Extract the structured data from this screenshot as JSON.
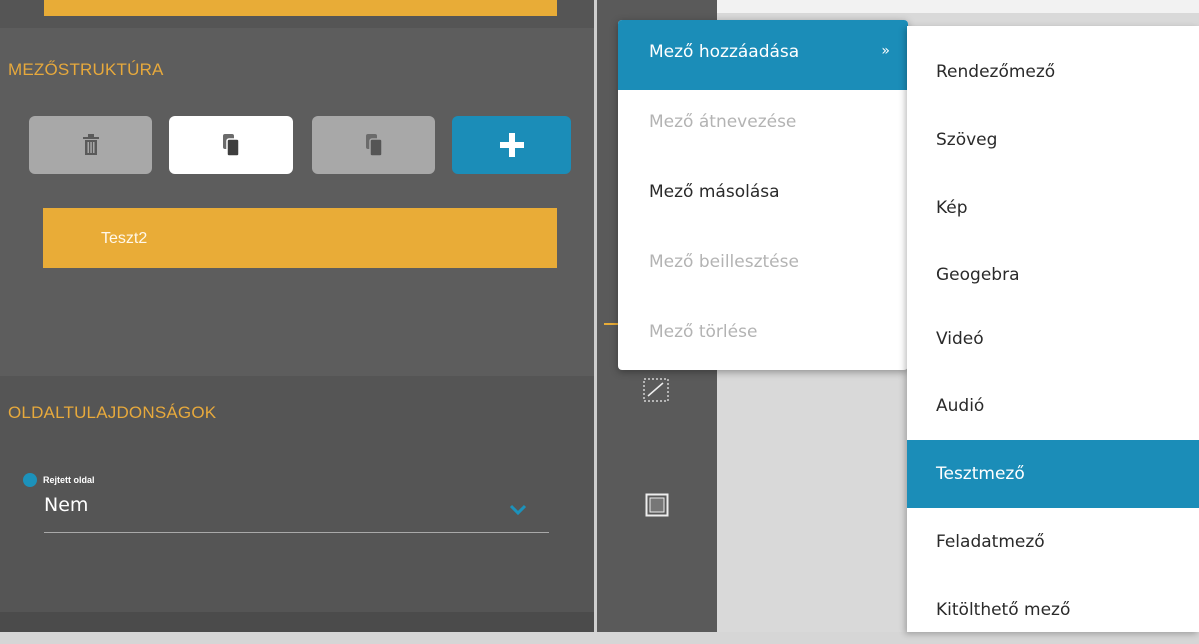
{
  "left_panel": {
    "field_structure_title": "MEZŐSTRUKTÚRA",
    "toolbar": {
      "delete_icon": "trash-icon",
      "copy_icon": "copy-icon",
      "paste_icon": "paste-icon",
      "add_icon": "plus-icon"
    },
    "field_items": [
      {
        "label": "Teszt2"
      }
    ],
    "page_properties_title": "OLDALTULAJDONSÁGOK",
    "hidden_page": {
      "label": "Rejtett oldal",
      "value": "Nem"
    }
  },
  "context_menu": {
    "items": [
      {
        "label": "Mező hozzáadása",
        "arrow": "»",
        "state": "active"
      },
      {
        "label": "Mező átnevezése",
        "state": "disabled"
      },
      {
        "label": "Mező másolása",
        "state": "enabled"
      },
      {
        "label": "Mező beillesztése",
        "state": "disabled"
      },
      {
        "label": "Mező törlése",
        "state": "disabled"
      }
    ]
  },
  "submenu": {
    "items": [
      {
        "label": "Rendezőmező"
      },
      {
        "label": "Szöveg"
      },
      {
        "label": "Kép"
      },
      {
        "label": "Geogebra"
      },
      {
        "label": "Videó"
      },
      {
        "label": "Audió"
      },
      {
        "label": "Tesztmező",
        "selected": true
      },
      {
        "label": "Feladatmező"
      },
      {
        "label": "Kitölthető mező"
      }
    ]
  },
  "colors": {
    "accent_orange": "#e8ac37",
    "accent_blue": "#1b8db8",
    "panel_bg": "#5d5d5d"
  }
}
